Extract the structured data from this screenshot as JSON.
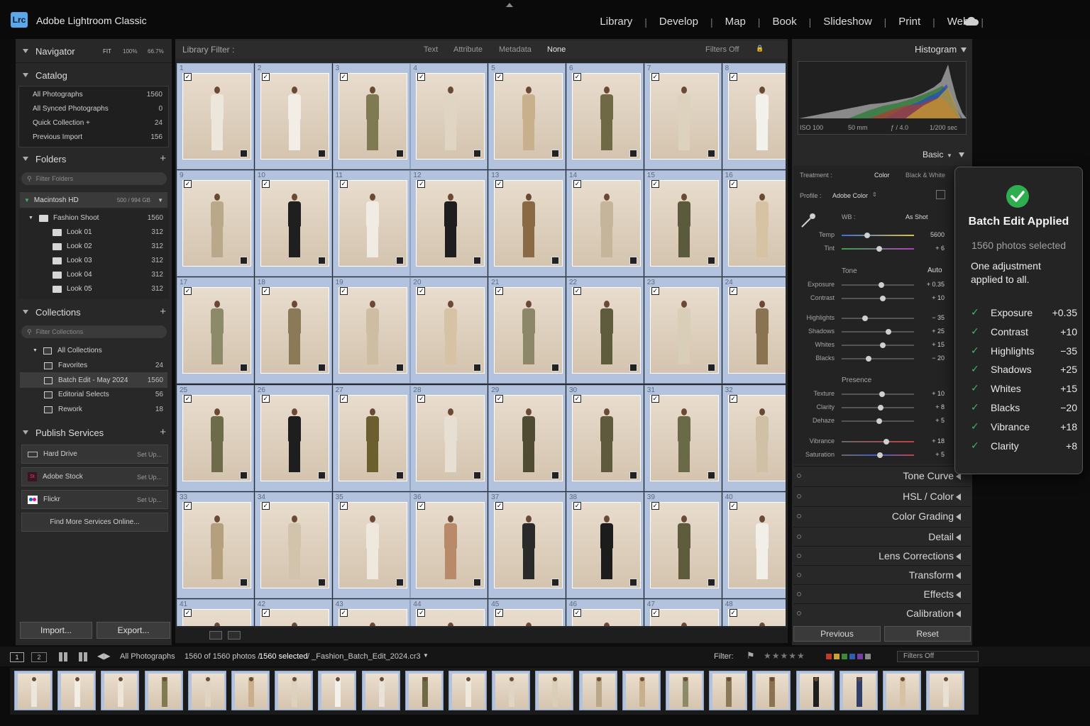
{
  "app": {
    "logo": "Lrc",
    "name": "Adobe Lightroom Classic"
  },
  "modules": [
    "Library",
    "Develop",
    "Map",
    "Book",
    "Slideshow",
    "Print",
    "Web"
  ],
  "left": {
    "navigator": {
      "title": "Navigator",
      "fit": "FIT",
      "z1": "100%",
      "z2": "66.7%"
    },
    "catalog": {
      "title": "Catalog",
      "items": [
        {
          "label": "All Photographs",
          "count": "1560"
        },
        {
          "label": "All Synced Photographs",
          "count": "0"
        },
        {
          "label": "Quick Collection +",
          "count": "24"
        },
        {
          "label": "Previous Import",
          "count": "156"
        }
      ]
    },
    "folders": {
      "title": "Folders",
      "search": "Filter Folders",
      "drive": "Macintosh HD",
      "drive_space": "500 / 994 GB",
      "items": [
        {
          "label": "Fashion Shoot",
          "count": "1560"
        },
        {
          "label": "Look 01",
          "count": "312"
        },
        {
          "label": "Look 02",
          "count": "312"
        },
        {
          "label": "Look 03",
          "count": "312"
        },
        {
          "label": "Look 04",
          "count": "312"
        },
        {
          "label": "Look 05",
          "count": "312"
        }
      ]
    },
    "collections": {
      "title": "Collections",
      "search": "Filter Collections",
      "items": [
        {
          "label": "All Collections",
          "count": ""
        },
        {
          "label": "Favorites",
          "count": "24"
        },
        {
          "label": "Batch Edit - May 2024",
          "count": "1560"
        },
        {
          "label": "Editorial Selects",
          "count": "56"
        },
        {
          "label": "Rework",
          "count": "18"
        }
      ]
    },
    "publish": {
      "title": "Publish Services",
      "items": [
        {
          "label": "Hard Drive",
          "setup": "Set Up..."
        },
        {
          "label": "Adobe Stock",
          "setup": "Set Up..."
        },
        {
          "label": "Flickr",
          "setup": "Set Up..."
        }
      ],
      "more": "Find More Services Online..."
    },
    "import": "Import...",
    "export": "Export..."
  },
  "filterbar": {
    "label": "Library Filter :",
    "tabs": [
      "Text",
      "Attribute",
      "Metadata",
      "None"
    ],
    "status": "Filters Off"
  },
  "grid": {
    "cells": [
      {
        "n": "1",
        "c": "#ede6da"
      },
      {
        "n": "2",
        "c": "#f2eee6"
      },
      {
        "n": "3",
        "c": "#7f7a52"
      },
      {
        "n": "4",
        "c": "#e0d5c2"
      },
      {
        "n": "5",
        "c": "#c9b08c"
      },
      {
        "n": "6",
        "c": "#6f6a45"
      },
      {
        "n": "7",
        "c": "#ddd2bd"
      },
      {
        "n": "8",
        "c": "#f3f1ec"
      },
      {
        "n": "9",
        "c": "#b9a98a"
      },
      {
        "n": "10",
        "c": "#1f1f1f"
      },
      {
        "n": "11",
        "c": "#f0ebe3"
      },
      {
        "n": "12",
        "c": "#1e1e1e"
      },
      {
        "n": "13",
        "c": "#8a6a45"
      },
      {
        "n": "14",
        "c": "#c5b59a"
      },
      {
        "n": "15",
        "c": "#5c5a3c"
      },
      {
        "n": "16",
        "c": "#d5c3a3"
      },
      {
        "n": "17",
        "c": "#8d8a6a"
      },
      {
        "n": "18",
        "c": "#8b7a58"
      },
      {
        "n": "19",
        "c": "#cdbda3"
      },
      {
        "n": "20",
        "c": "#d6c2a4"
      },
      {
        "n": "21",
        "c": "#8c8768"
      },
      {
        "n": "22",
        "c": "#5f5c3e"
      },
      {
        "n": "23",
        "c": "#d9ceb8"
      },
      {
        "n": "24",
        "c": "#8a7350"
      },
      {
        "n": "25",
        "c": "#6d6b49"
      },
      {
        "n": "26",
        "c": "#1e1e1e"
      },
      {
        "n": "27",
        "c": "#6b5f2f"
      },
      {
        "n": "28",
        "c": "#e7e0d2"
      },
      {
        "n": "29",
        "c": "#4f4a32"
      },
      {
        "n": "30",
        "c": "#5f5a3d"
      },
      {
        "n": "31",
        "c": "#6b6a48"
      },
      {
        "n": "32",
        "c": "#cfc0a6"
      },
      {
        "n": "33",
        "c": "#b4a07d"
      },
      {
        "n": "34",
        "c": "#d2c4ac"
      },
      {
        "n": "35",
        "c": "#efe9dd"
      },
      {
        "n": "36",
        "c": "#b88a6a"
      },
      {
        "n": "37",
        "c": "#2a2a2a"
      },
      {
        "n": "38",
        "c": "#1c1c1c"
      },
      {
        "n": "39",
        "c": "#5e5c3c"
      },
      {
        "n": "40",
        "c": "#f2efe9"
      },
      {
        "n": "41",
        "c": "#d9ceb8"
      },
      {
        "n": "42",
        "c": "#d9ceb8"
      },
      {
        "n": "43",
        "c": "#d9ceb8"
      },
      {
        "n": "44",
        "c": "#d9ceb8"
      },
      {
        "n": "45",
        "c": "#d9ceb8"
      },
      {
        "n": "46",
        "c": "#d9ceb8"
      },
      {
        "n": "47",
        "c": "#d9ceb8"
      },
      {
        "n": "48",
        "c": "#d9ceb8"
      }
    ]
  },
  "right": {
    "histogram": {
      "title": "Histogram",
      "iso": "ISO 100",
      "focal": "50 mm",
      "aperture": "ƒ / 4.0",
      "shutter": "1/200 sec"
    },
    "basic": {
      "title": "Basic",
      "treatment_label": "Treatment :",
      "color": "Color",
      "bw": "Black & White",
      "profile_label": "Profile :",
      "profile": "Adobe Color",
      "wb_label": "WB :",
      "wb": "As Shot",
      "tone": "Tone",
      "auto": "Auto",
      "presence": "Presence",
      "sliders": [
        {
          "label": "Temp",
          "value": "5600",
          "pos": 0.35
        },
        {
          "label": "Tint",
          "value": "+ 6",
          "pos": 0.52
        },
        {
          "label": "Exposure",
          "value": "+ 0.35",
          "pos": 0.55
        },
        {
          "label": "Contrast",
          "value": "+ 10",
          "pos": 0.57
        },
        {
          "label": "Highlights",
          "value": "− 35",
          "pos": 0.32
        },
        {
          "label": "Shadows",
          "value": "+ 25",
          "pos": 0.65
        },
        {
          "label": "Whites",
          "value": "+ 15",
          "pos": 0.57
        },
        {
          "label": "Blacks",
          "value": "− 20",
          "pos": 0.37
        },
        {
          "label": "Texture",
          "value": "+ 10",
          "pos": 0.56
        },
        {
          "label": "Clarity",
          "value": "+ 8",
          "pos": 0.54
        },
        {
          "label": "Dehaze",
          "value": "+ 5",
          "pos": 0.52
        },
        {
          "label": "Vibrance",
          "value": "+ 18",
          "pos": 0.62
        },
        {
          "label": "Saturation",
          "value": "+ 5",
          "pos": 0.53
        }
      ]
    },
    "panels": [
      "Tone Curve",
      "HSL / Color",
      "Color Grading",
      "Detail",
      "Lens Corrections",
      "Transform",
      "Effects",
      "Calibration"
    ],
    "previous": "Previous",
    "reset": "Reset"
  },
  "toast": {
    "title": "Batch Edit Applied",
    "subtitle": "1560 photos selected",
    "line1": "One adjustment",
    "line2": "applied to all.",
    "items": [
      {
        "name": "Exposure",
        "value": "+0.35"
      },
      {
        "name": "Contrast",
        "value": "+10"
      },
      {
        "name": "Highlights",
        "value": "−35"
      },
      {
        "name": "Shadows",
        "value": "+25"
      },
      {
        "name": "Whites",
        "value": "+15"
      },
      {
        "name": "Blacks",
        "value": "−20"
      },
      {
        "name": "Vibrance",
        "value": "+18"
      },
      {
        "name": "Clarity",
        "value": "+8"
      }
    ]
  },
  "status": {
    "view1": "1",
    "view2": "2",
    "source": "All Photographs",
    "count": "1560 of 1560 photos /",
    "selected": "1560 selected",
    "file": "/ _Fashion_Batch_Edit_2024.cr3",
    "filter_label": "Filter:",
    "filters_off": "Filters Off"
  },
  "filmstrip": {
    "colors": [
      "#ede6da",
      "#f2eee6",
      "#ece5d8",
      "#7f7a52",
      "#e0d5c2",
      "#c9b08c",
      "#ddd2bd",
      "#f3f1ec",
      "#e8e2d8",
      "#6f6a45",
      "#efe9dd",
      "#e0d5c2",
      "#d9ceb8",
      "#b9a98a",
      "#c9b08c",
      "#8d8a6a",
      "#8b7a58",
      "#8a7350",
      "#1e1e1e",
      "#2f3f6a",
      "#d6c2a4",
      "#e8e0d2"
    ]
  }
}
